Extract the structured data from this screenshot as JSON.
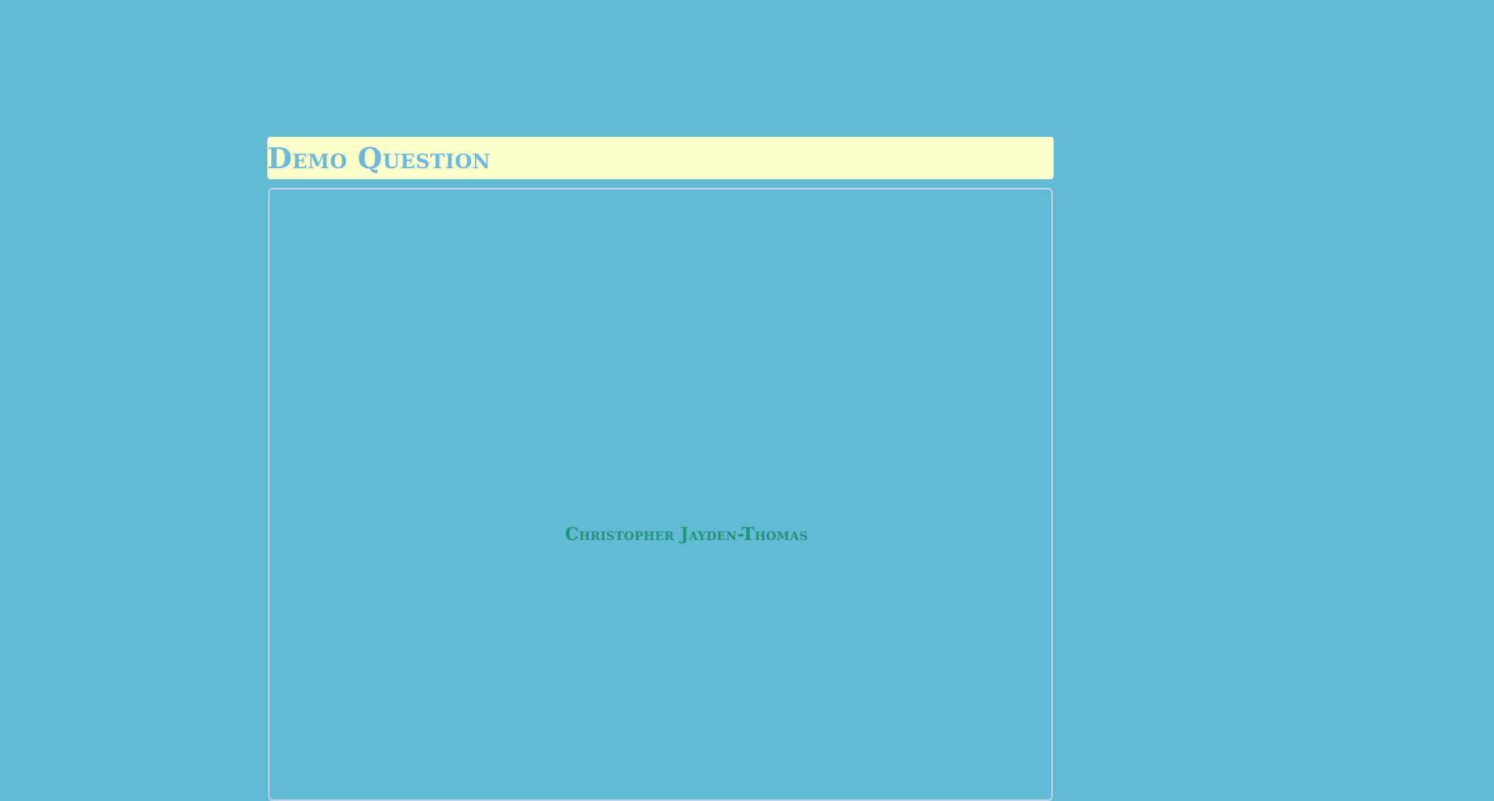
{
  "page": {
    "background_color": "#61bbd4"
  },
  "header": {
    "title": "Demo Question",
    "background_color": "#ffffc9",
    "text_color": "#6ab9df"
  },
  "panel": {
    "border_color": "#c6cfe8",
    "name": "Christopher Jayden-Thomas",
    "name_color": "#209477"
  }
}
